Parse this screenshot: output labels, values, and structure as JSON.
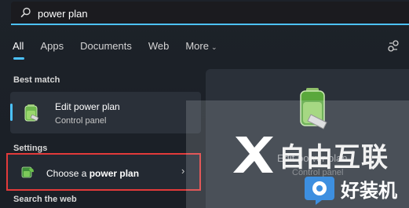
{
  "search": {
    "query": "power plan"
  },
  "tabs": [
    {
      "label": "All",
      "active": true
    },
    {
      "label": "Apps"
    },
    {
      "label": "Documents"
    },
    {
      "label": "Web"
    },
    {
      "label": "More",
      "dropdown": true
    }
  ],
  "sections": {
    "best_match": "Best match",
    "settings": "Settings",
    "search_web": "Search the web"
  },
  "best_match": {
    "title_prefix": "Edit ",
    "title_bold": "power plan",
    "subtitle": "Control panel",
    "icon": "battery-plug-icon"
  },
  "settings_result": {
    "label_prefix": "Choose a ",
    "label_bold": "power plan",
    "icon": "battery-leaf-icon",
    "highlight_color": "#e23a3a"
  },
  "preview": {
    "title": "Edit power plan",
    "subtitle": "Control panel"
  },
  "watermark": {
    "line1": "自由互联",
    "logo_text": "好装机"
  },
  "colors": {
    "accent": "#4cc2ff",
    "background": "#1c2128",
    "card": "#2a3039"
  }
}
